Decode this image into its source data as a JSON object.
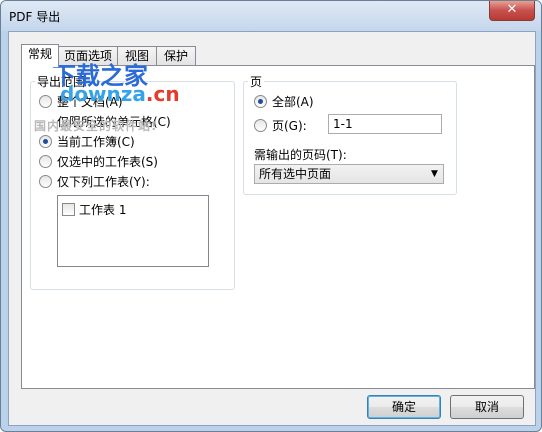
{
  "window": {
    "title": "PDF 导出",
    "close_symbol": "✕"
  },
  "tabs": [
    {
      "label": "常规",
      "active": true
    },
    {
      "label": "页面选项",
      "active": false
    },
    {
      "label": "视图",
      "active": false
    },
    {
      "label": "保护",
      "active": false
    }
  ],
  "export_range": {
    "legend": "导出范围",
    "whole_doc": "整个文档(A)",
    "selected_cells": "仅限所选的单元格(C)",
    "current_workbook": "当前工作簿(C)",
    "selected_sheets": "仅选中的工作表(S)",
    "following_sheets": "仅下列工作表(Y):",
    "sheet_list": [
      {
        "label": "工作表 1",
        "checked": false
      }
    ]
  },
  "pages": {
    "legend": "页",
    "all_label": "全部(A)",
    "page_label": "页(G):",
    "page_value": "1-1",
    "output_label": "需输出的页码(T):",
    "output_value": "所有选中页面"
  },
  "buttons": {
    "ok": "确定",
    "cancel": "取消"
  },
  "watermark": {
    "brand": "下载之家",
    "domain_prefix": "downza",
    "domain_suffix": ".cn",
    "tagline": "国内最安全的软件站!"
  },
  "colors": {
    "titlebar": "#c4d6ec",
    "close": "#c75050",
    "radio_dot": "#1b4f9b",
    "watermark": "#2a6bd8"
  }
}
